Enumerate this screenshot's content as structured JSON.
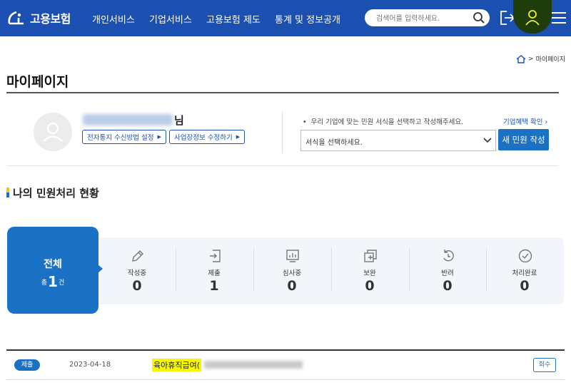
{
  "header": {
    "logo_text": "고용보험",
    "nav": [
      "개인서비스",
      "기업서비스",
      "고용보험 제도",
      "통계 및 정보공개"
    ],
    "search_placeholder": "검색어를 입력하세요.",
    "icons": [
      "logout-icon",
      "user-icon",
      "menu-icon"
    ],
    "accent": "#1b4fb0"
  },
  "breadcrumb": {
    "current": "마이페이지"
  },
  "page_title": "마이페이지",
  "profile": {
    "name_suffix": "님",
    "buttons": [
      "전자통지 수신방법 설정",
      "사업장정보 수정하기"
    ]
  },
  "petition": {
    "notice": "우리 기업에 맞는 민원 서식을 선택하고 작성해주세요.",
    "benefit_link": "기업혜택 확인",
    "select_placeholder": "서식을 선택하세요.",
    "new_button": "새 민원 작성"
  },
  "status": {
    "title": "나의 민원처리 현황",
    "all_label": "전체",
    "all_prefix": "총",
    "all_count": "1",
    "all_suffix": "건",
    "items": [
      {
        "label": "작성중",
        "count": "0",
        "icon": "pencil-icon"
      },
      {
        "label": "제출",
        "count": "1",
        "icon": "submit-icon"
      },
      {
        "label": "심사중",
        "count": "0",
        "icon": "review-icon"
      },
      {
        "label": "보완",
        "count": "0",
        "icon": "supplement-icon"
      },
      {
        "label": "반려",
        "count": "0",
        "icon": "return-icon"
      },
      {
        "label": "처리완료",
        "count": "0",
        "icon": "check-icon"
      }
    ]
  },
  "list": [
    {
      "status": "제출",
      "date": "2023-04-18",
      "title": "육아휴직급여(",
      "action": "회수"
    }
  ]
}
